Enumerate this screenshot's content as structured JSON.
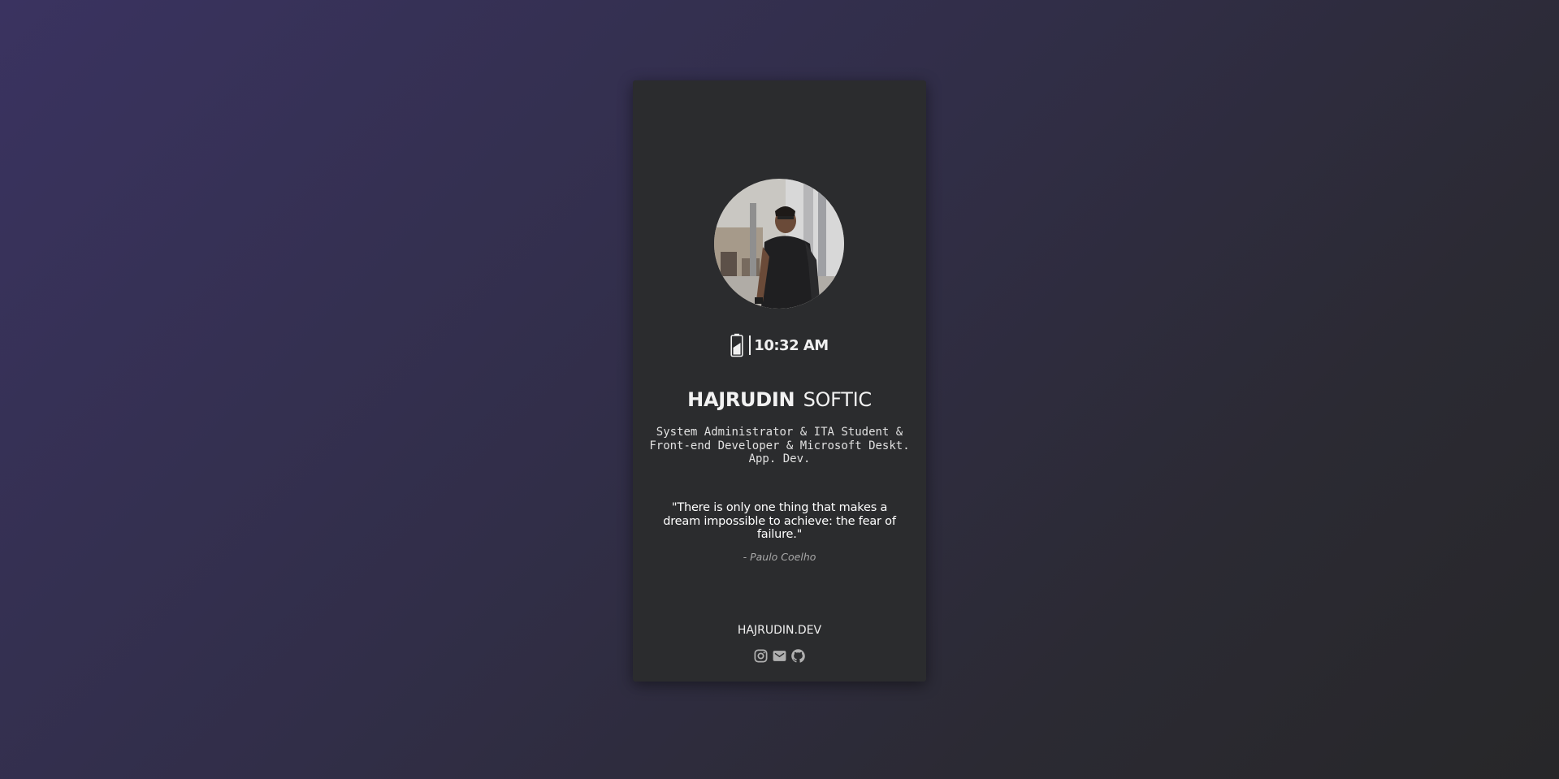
{
  "profile": {
    "avatar_alt": "profile photo",
    "first_name": "HAJRUDIN",
    "last_name": "SOFTIC",
    "role": "System Administrator & ITA Student & Front-end Developer & Microsoft Deskt. App. Dev."
  },
  "status": {
    "time": "10:32 AM",
    "battery_icon": "battery-charging-icon"
  },
  "quote": {
    "text": "\"There is only one thing that makes a dream impossible to achieve: the fear of failure.\"",
    "author": "- Paulo Coelho"
  },
  "footer": {
    "site": "HAJRUDIN.DEV",
    "socials": [
      {
        "icon": "instagram-icon"
      },
      {
        "icon": "mail-icon"
      },
      {
        "icon": "github-icon"
      }
    ]
  },
  "colors": {
    "card_background": "#2b2c2e",
    "text_primary": "#f2f2f2",
    "text_muted": "#a8a8a8",
    "icon_color": "#b0b0b0"
  }
}
